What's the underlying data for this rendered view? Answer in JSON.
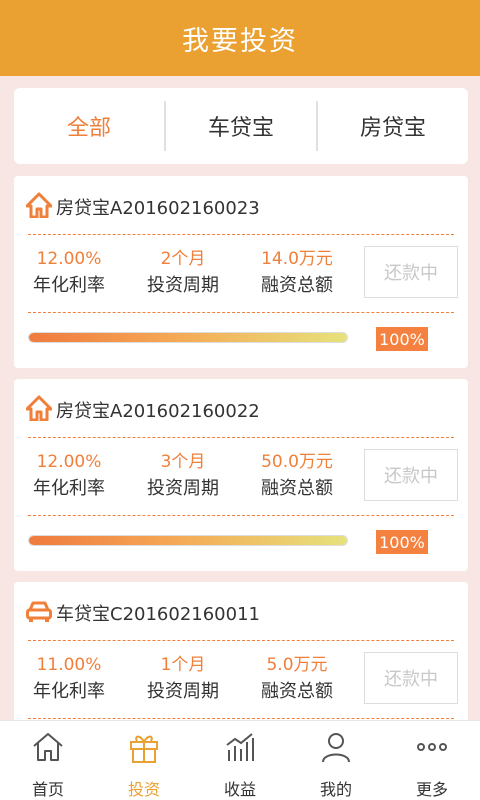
{
  "header": {
    "title": "我要投资"
  },
  "tabs": [
    {
      "label": "全部"
    },
    {
      "label": "车贷宝"
    },
    {
      "label": "房贷宝"
    }
  ],
  "products": [
    {
      "title": "房贷宝A201602160023",
      "icon": "house-icon",
      "rate": "12.00%",
      "rate_label": "年化利率",
      "period": "2个月",
      "period_label": "投资周期",
      "amount": "14.0万元",
      "amount_label": "融资总额",
      "status": "还款中",
      "progress_value": 100,
      "progress_text": "100%"
    },
    {
      "title": "房贷宝A201602160022",
      "icon": "house-icon",
      "rate": "12.00%",
      "rate_label": "年化利率",
      "period": "3个月",
      "period_label": "投资周期",
      "amount": "50.0万元",
      "amount_label": "融资总额",
      "status": "还款中",
      "progress_value": 100,
      "progress_text": "100%"
    },
    {
      "title": "车贷宝C201602160011",
      "icon": "car-icon",
      "rate": "11.00%",
      "rate_label": "年化利率",
      "period": "1个月",
      "period_label": "投资周期",
      "amount": "5.0万元",
      "amount_label": "融资总额",
      "status": "还款中"
    }
  ],
  "nav": [
    {
      "label": "首页",
      "icon": "home-icon"
    },
    {
      "label": "投资",
      "icon": "gift-icon"
    },
    {
      "label": "收益",
      "icon": "chart-icon"
    },
    {
      "label": "我的",
      "icon": "user-icon"
    },
    {
      "label": "更多",
      "icon": "more-icon"
    }
  ],
  "colors": {
    "accent": "#eaa131",
    "highlight": "#f07f3a",
    "background": "#f7e6e4"
  }
}
